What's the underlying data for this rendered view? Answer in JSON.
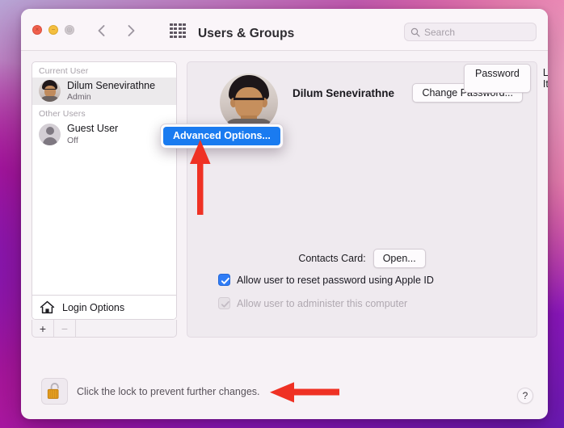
{
  "window": {
    "title": "Users & Groups",
    "traffic_lights": [
      {
        "name": "close",
        "glyph": "×",
        "color": "#f1604d"
      },
      {
        "name": "minimize",
        "glyph": "−",
        "color": "#f5bf3f"
      },
      {
        "name": "zoom",
        "glyph": "◎",
        "color": "#d2cbd0"
      }
    ],
    "nav": {
      "back_icon": "chevron-left-icon",
      "forward_icon": "chevron-right-icon"
    },
    "grid_icon": "grid-apps-icon"
  },
  "search": {
    "placeholder": "Search",
    "value": "",
    "icon": "search-icon"
  },
  "sidebar": {
    "groups": [
      {
        "header": "Current User",
        "users": [
          {
            "name": "Dilum Senevirathne",
            "status": "Admin",
            "avatar": "user-photo-avatar",
            "selected": true
          }
        ]
      },
      {
        "header": "Other Users",
        "users": [
          {
            "name": "Guest User",
            "status": "Off",
            "avatar": "generic-person-avatar",
            "selected": false
          }
        ]
      }
    ],
    "login_options": {
      "label": "Login Options",
      "icon": "home-icon"
    },
    "toolbar": {
      "add_label": "+",
      "remove_label": "−",
      "remove_disabled": true
    }
  },
  "main": {
    "tabs": [
      {
        "label": "Password",
        "active": true
      },
      {
        "label": "Login Items",
        "active": false
      }
    ],
    "user_fullname": "Dilum Senevirathne",
    "avatar": "user-photo-avatar-large",
    "change_password_label": "Change Password...",
    "contacts_card_label": "Contacts Card:",
    "contacts_open_label": "Open...",
    "checkboxes": [
      {
        "label": "Allow user to reset password using Apple ID",
        "checked": true,
        "disabled": false
      },
      {
        "label": "Allow user to administer this computer",
        "checked": true,
        "disabled": true
      }
    ]
  },
  "context_menu": {
    "items": [
      {
        "label": "Advanced Options...",
        "highlighted": true
      }
    ]
  },
  "footer": {
    "lock_text": "Click the lock to prevent further changes.",
    "lock_icon": "unlocked-padlock-icon",
    "help_label": "?"
  },
  "annotations": {
    "color": "#ef3124",
    "arrows": [
      {
        "name": "arrow-pointing-to-advanced-options",
        "direction": "up"
      },
      {
        "name": "arrow-pointing-to-lock-text",
        "direction": "left"
      }
    ]
  }
}
